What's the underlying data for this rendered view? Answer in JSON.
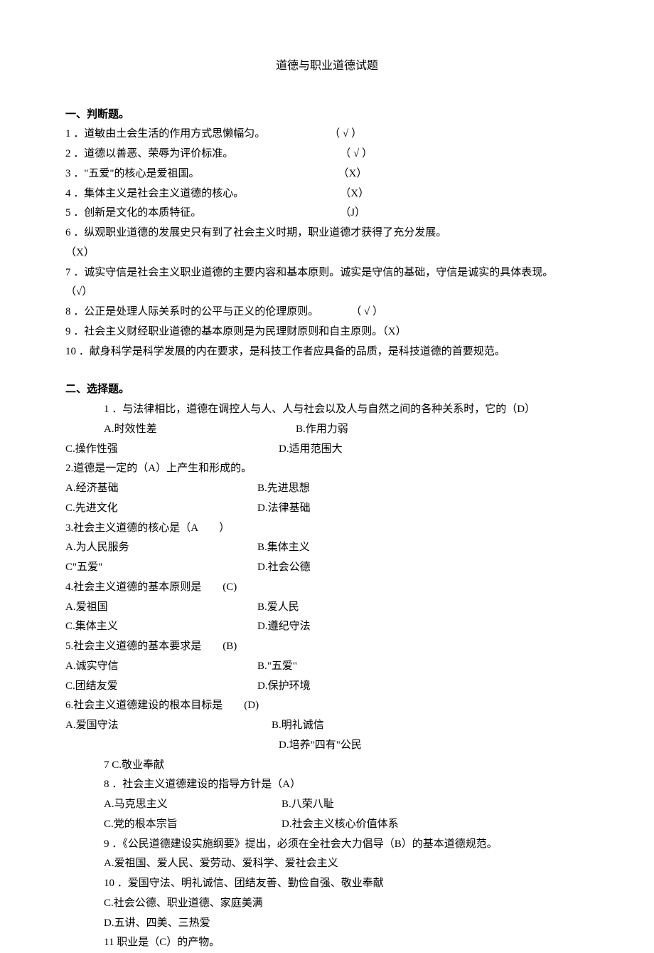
{
  "title": "道德与职业道德试题",
  "section1": {
    "heading": "一、判断题。",
    "items": [
      "1 ．道敏由土会生活的作用方式思懒幅匀。　　　　　　　（ √ ）",
      "2  ．道德以善恶、荣辱为评价标准。　　　　　　　　　　　（ √ ）",
      "3  ．\"五爱\"的核心是爱祖国。　　　　　　　　　　　　　　（X）",
      "4  ．集体主义是社会主义道德的核心。　　　　　　　　　　（X）",
      "5  ．创新是文化的本质特征。　　　　　　　　　　　　　　（J）",
      "6  ．纵观职业道德的发展史只有到了社会主义时期，职业道德才获得了充分发展。",
      "7  ．诚实守信是社会主义职业道德的主要内容和基本原则。诚实是守信的基础，守信是诚实的具体表现。",
      "8  ．公正是处理人际关系时的公平与正义的伦理原则。　　　　（ √ ）",
      "9  ．社会主义财经职业道德的基本原则是为民理财原则和自主原则。（X）",
      "10  ．献身科学是科学发展的内在要求，是科技工作者应具备的品质，是科技道德的首要规范。"
    ],
    "ans6": "（X）",
    "ans7": "（√）"
  },
  "section2": {
    "heading": "二、选择题。",
    "q1": {
      "stem": "1 ．与法律相比，道德在调控人与人、人与社会以及人与自然之间的各种关系时，它的（D）",
      "a": "A.时效性差",
      "b": "B.作用力弱",
      "c": "C.操作性强",
      "d": "D.适用范围大"
    },
    "q2": {
      "stem": "2.道德是一定的（A）上产生和形成的。",
      "a": "A.经济基础",
      "b": "B.先进思想",
      "c": "C.先进文化",
      "d": "D.法律基础"
    },
    "q3": {
      "stem": "3.社会主义道德的核心是（A　　）",
      "a": "A.为人民服务",
      "b": "B.集体主义",
      "c": "C\"五爱\"",
      "d": "D.社会公德"
    },
    "q4": {
      "stem": "4.社会主义道德的基本原则是　　(C)",
      "a": "A.爱祖国",
      "b": "B.爱人民",
      "c": "C.集体主义",
      "d": "D.遵纪守法"
    },
    "q5": {
      "stem": "5.社会主义道德的基本要求是　　(B)",
      "a": "A.诚实守信",
      "b": "B.\"五爱\"",
      "c": "C.团结友爱",
      "d": "D.保护环境"
    },
    "q6": {
      "stem": "6.社会主义道德建设的根本目标是　　(D)",
      "a": "A.爱国守法",
      "b": "B.明礼诚信",
      "d": "D.培养\"四有\"公民",
      "c": "7  C.敬业奉献"
    },
    "q8": {
      "stem": "8  ．社会主义道德建设的指导方针是（A）",
      "a": "A.马克思主义",
      "b": "B.八荣八耻",
      "c": "C.党的根本宗旨",
      "d": "D.社会主义核心价值体系"
    },
    "q9": {
      "stem": "9  ．《公民道德建设实施纲要》提出，必须在全社会大力倡导（B）的基本道德规范。",
      "a": "A.爱祖国、爱人民、爱劳动、爱科学、爱社会主义",
      "b": "10 ．爱国守法、明礼诚信、团结友善、勤俭自强、敬业奉献",
      "c": "C.社会公德、职业道德、家庭美满",
      "d": "D.五讲、四美、三热爱"
    },
    "q11": {
      "stem": "11  职业是（C）的产物。"
    }
  }
}
